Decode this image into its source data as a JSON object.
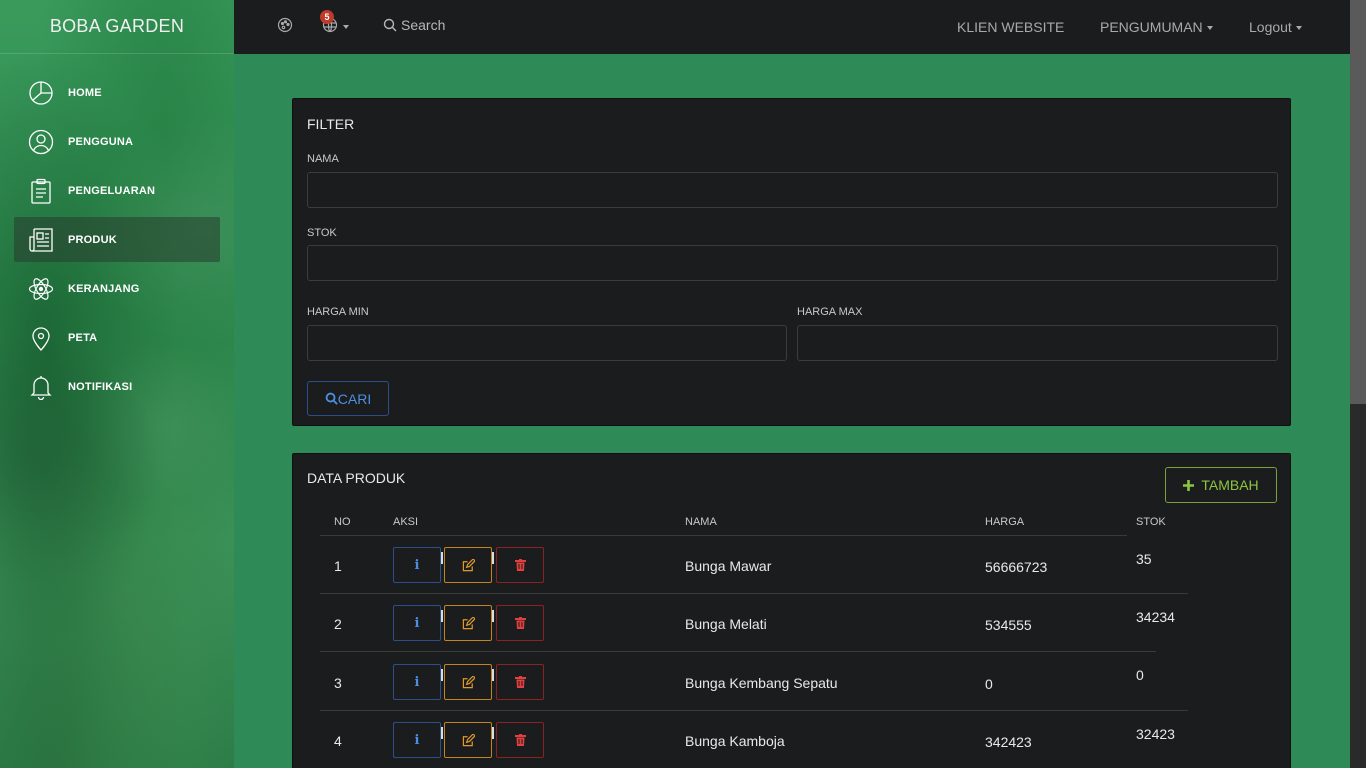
{
  "brand": "BOBA GARDEN",
  "sidebar": {
    "items": [
      {
        "label": "HOME",
        "icon": "pie-chart-icon"
      },
      {
        "label": "PENGGUNA",
        "icon": "user-icon"
      },
      {
        "label": "PENGELUARAN",
        "icon": "clipboard-icon"
      },
      {
        "label": "PRODUK",
        "icon": "newspaper-icon",
        "active": true
      },
      {
        "label": "KERANJANG",
        "icon": "atom-icon"
      },
      {
        "label": "PETA",
        "icon": "map-pin-icon"
      },
      {
        "label": "NOTIFIKASI",
        "icon": "bell-icon"
      }
    ]
  },
  "topbar": {
    "notif_count": "5",
    "search_placeholder": "Search",
    "links": {
      "klien": "KLIEN WEBSITE",
      "pengumuman": "PENGUMUMAN",
      "logout": "Logout"
    }
  },
  "filter": {
    "title": "FILTER",
    "nama_label": "NAMA",
    "stok_label": "STOK",
    "harga_min_label": "HARGA MIN",
    "harga_max_label": "HARGA MAX",
    "cari_label": "CARI"
  },
  "data_produk": {
    "title": "DATA PRODUK",
    "tambah_label": "TAMBAH",
    "columns": {
      "no": "NO",
      "aksi": "AKSI",
      "nama": "NAMA",
      "harga": "HARGA",
      "stok": "STOK"
    },
    "rows": [
      {
        "no": "1",
        "nama": "Bunga Mawar",
        "harga": "56666723",
        "stok": "35"
      },
      {
        "no": "2",
        "nama": "Bunga Melati",
        "harga": "534555",
        "stok": "34234"
      },
      {
        "no": "3",
        "nama": "Bunga Kembang Sepatu",
        "harga": "0",
        "stok": "0"
      },
      {
        "no": "4",
        "nama": "Bunga Kamboja",
        "harga": "342423",
        "stok": "32423"
      }
    ]
  },
  "colors": {
    "accent_green": "#2e8b57",
    "panel_bg": "#1b1c1e",
    "info": "#4c8fe0",
    "warning": "#e09a2a",
    "danger": "#e04040",
    "success": "#8cc63f"
  }
}
